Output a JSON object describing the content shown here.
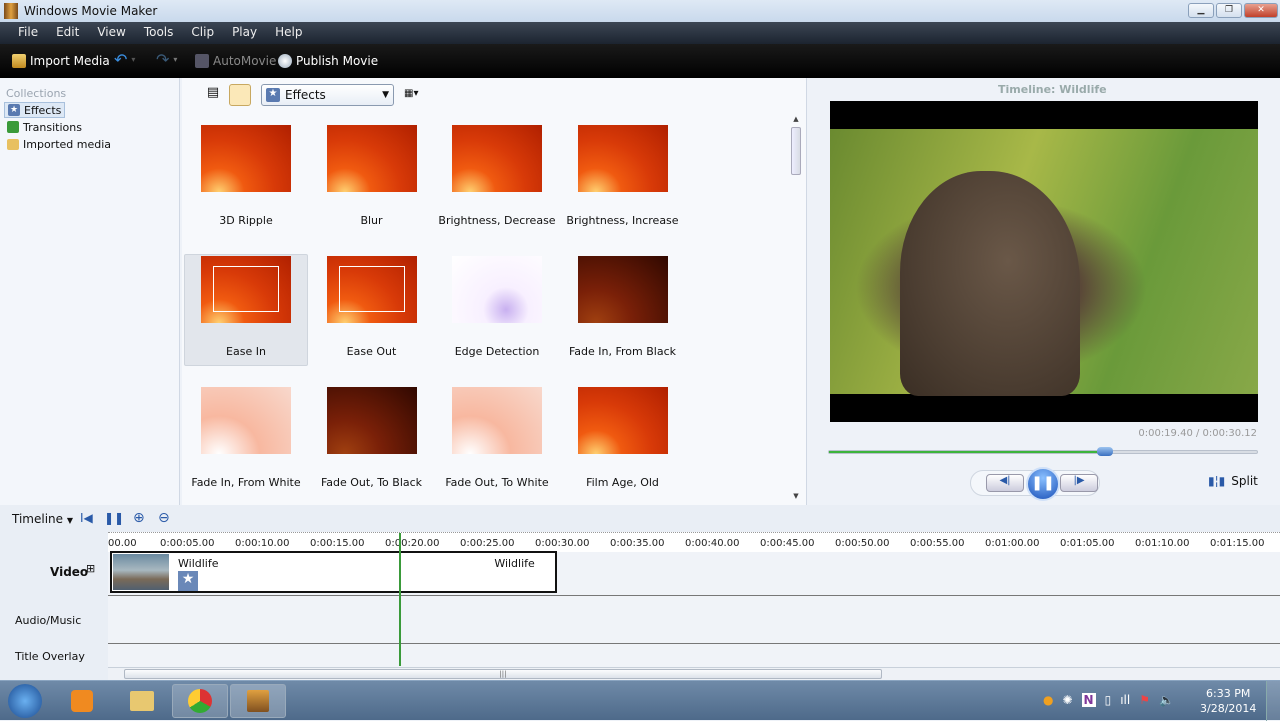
{
  "window": {
    "title": "Windows Movie Maker"
  },
  "menu": [
    "File",
    "Edit",
    "View",
    "Tools",
    "Clip",
    "Play",
    "Help"
  ],
  "toolbar": {
    "import": "Import Media",
    "automovie": "AutoMovie",
    "publish": "Publish Movie"
  },
  "collections": {
    "header": "Collections",
    "items": [
      {
        "label": "Effects",
        "selected": true
      },
      {
        "label": "Transitions"
      },
      {
        "label": "Imported media"
      }
    ]
  },
  "gallery": {
    "combo": "Effects",
    "items": [
      {
        "label": "3D Ripple",
        "style": "normal"
      },
      {
        "label": "Blur",
        "style": "normal"
      },
      {
        "label": "Brightness, Decrease",
        "style": "normal"
      },
      {
        "label": "Brightness, Increase",
        "style": "normal"
      },
      {
        "label": "Ease In",
        "style": "ease",
        "selected": true
      },
      {
        "label": "Ease Out",
        "style": "ease"
      },
      {
        "label": "Edge Detection",
        "style": "edge"
      },
      {
        "label": "Fade In, From Black",
        "style": "dark"
      },
      {
        "label": "Fade In, From White",
        "style": "light"
      },
      {
        "label": "Fade Out, To Black",
        "style": "dark"
      },
      {
        "label": "Fade Out, To White",
        "style": "light"
      },
      {
        "label": "Film Age, Old",
        "style": "normal"
      }
    ]
  },
  "preview": {
    "title": "Timeline: Wildlife",
    "time": "0:00:19.40 / 0:00:30.12",
    "progress": 0.644,
    "split": "Split"
  },
  "timeline": {
    "label": "Timeline",
    "ruler": [
      "00.00",
      "0:00:05.00",
      "0:00:10.00",
      "0:00:15.00",
      "0:00:20.00",
      "0:00:25.00",
      "0:00:30.00",
      "0:00:35.00",
      "0:00:40.00",
      "0:00:45.00",
      "0:00:50.00",
      "0:00:55.00",
      "0:01:00.00",
      "0:01:05.00",
      "0:01:10.00",
      "0:01:15.00"
    ],
    "tracks": {
      "video": "Video",
      "audio": "Audio/Music",
      "title": "Title Overlay"
    },
    "clip": {
      "name_start": "Wildlife",
      "name_end": "Wildlife",
      "duration_s": 30.12
    },
    "playhead_s": 19.4
  },
  "taskbar": {
    "time": "6:33 PM",
    "date": "3/28/2014"
  }
}
